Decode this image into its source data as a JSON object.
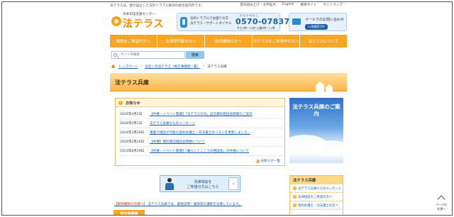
{
  "topbar": {
    "tagline": "法テラスは、国が設立した法的トラブル解決の総合案内所です。",
    "links": [
      "音声読み上げ・文字拡大",
      "English",
      "携帯サイト",
      "サイトマップ"
    ]
  },
  "logo": {
    "org": "日本司法支援センター",
    "name": "法テラス"
  },
  "contact": {
    "line1": "法的トラブルでお困りの方",
    "line2": "法テラス・サポートダイヤル",
    "ruby": "おなやみなし",
    "phone": "0570-078374",
    "hours": "平日9時〜21時 土曜9時〜17時"
  },
  "mail": {
    "text": "メールでのお問い合わせ",
    "badge": "24時間受付中"
  },
  "gnav": [
    "相談をご希望の方へ",
    "法律専門家の方へ",
    "関係機関の方へ",
    "法テラスをご利用中の方へ",
    "法テラスについて"
  ],
  "search": {
    "placeholder": "サイト内検索",
    "button": "検索"
  },
  "breadcrumb": {
    "home": "トップページ",
    "middle": "お近くの法テラス（地方事務所一覧）",
    "current": "法テラス兵庫"
  },
  "page_title": "法テラス兵庫",
  "news": {
    "title": "お知らせ",
    "items": [
      {
        "date": "2024年4月2日",
        "text": "【共催・イベント開催】「法テラスの日」記念無料相談会開催のご案内"
      },
      {
        "date": "2024年4月1日",
        "text": "法テラス兵庫からのメッセージ"
      },
      {
        "date": "2024年3月29日",
        "text": "書面で相談が可能な契約弁護士・司法書士のリストを更新しました。"
      },
      {
        "date": "2024年2月26日",
        "text": "【共催】無料電話相談会開催について"
      },
      {
        "date": "2023年8月29日",
        "text": "【共催・イベント開催】「暮らしとこころの相談会」の共催について"
      }
    ],
    "more": "お知らせ一覧"
  },
  "promo": {
    "text": "法テラス兵庫のご案内"
  },
  "consult": {
    "line1": "法律相談を",
    "line2": "ご希望の方はこちら",
    "arrow": "›"
  },
  "legal_note": {
    "tag": "【関係機関の皆様へ】",
    "text": "法テラス兵庫では、業務説明・講演等の講師を派遣しています。"
  },
  "section_tab": "所在地情報",
  "side_menu": {
    "title": "法テラス兵庫",
    "items": [
      "法テラス兵庫からのメッセージ",
      "法律相談をご希望の方へ",
      "契約弁護士・司法書士の方へ"
    ]
  },
  "pagetop": {
    "line1": "ページの",
    "line2": "先頭へ"
  },
  "colors": {
    "accent": "#f5a623",
    "link": "#1a5fb4",
    "phone": "#1f5fa6"
  }
}
